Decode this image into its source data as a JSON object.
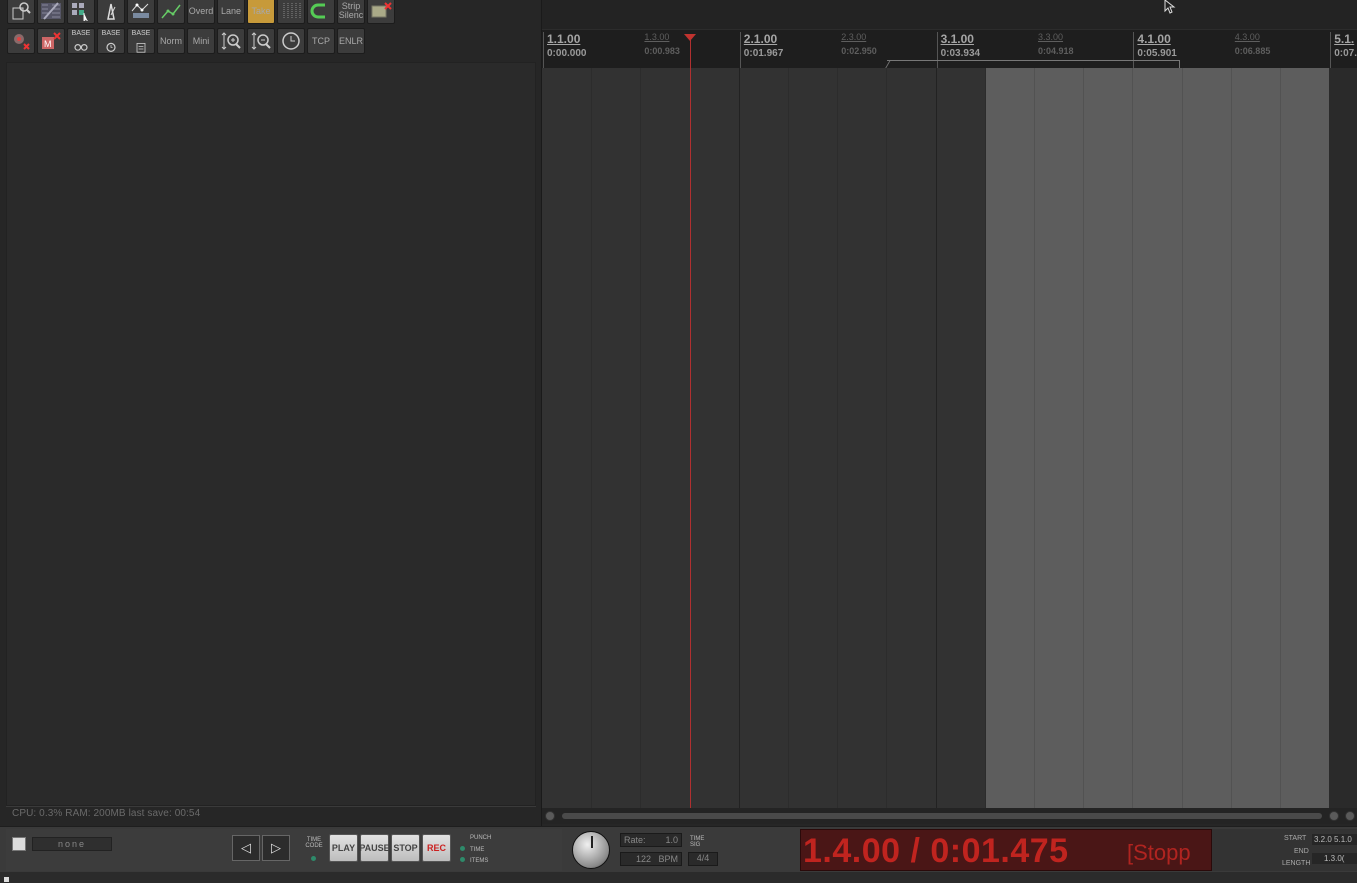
{
  "toolbar": {
    "row1": [
      {
        "name": "open-project-icon",
        "type": "icon"
      },
      {
        "name": "ripple-edit-icon",
        "type": "icon"
      },
      {
        "name": "grid-snap-icon",
        "type": "icon"
      },
      {
        "name": "metronome-icon",
        "type": "icon"
      },
      {
        "name": "envelope-points-icon",
        "type": "icon"
      },
      {
        "name": "automation-icon",
        "type": "icon"
      },
      {
        "name": "overdub-button",
        "label": "Overd"
      },
      {
        "name": "lane-button",
        "label": "Lane"
      },
      {
        "name": "take-button",
        "label": "Take"
      },
      {
        "name": "grid-lines-icon",
        "type": "icon"
      },
      {
        "name": "loop-icon",
        "type": "icon"
      },
      {
        "name": "strip-silence-button",
        "label": "Strip Silenc"
      },
      {
        "name": "remove-item-icon",
        "type": "icon"
      }
    ],
    "row2": [
      {
        "name": "record-arm-off-icon",
        "type": "icon"
      },
      {
        "name": "mute-clear-icon",
        "type": "icon"
      },
      {
        "name": "base-tape-icon",
        "label": "BASE"
      },
      {
        "name": "base-clock-icon",
        "label": "BASE"
      },
      {
        "name": "base-page-icon",
        "label": "BASE"
      },
      {
        "name": "norm-button",
        "label": "Norm"
      },
      {
        "name": "mini-button",
        "label": "Mini"
      },
      {
        "name": "zoom-in-vertical-icon",
        "type": "icon"
      },
      {
        "name": "zoom-out-vertical-icon",
        "type": "icon"
      },
      {
        "name": "clock-icon",
        "type": "icon"
      },
      {
        "name": "tcp-button",
        "label": "TCP"
      },
      {
        "name": "enlr-button",
        "label": "ENLR"
      }
    ]
  },
  "status": {
    "text": "CPU: 0.3%  RAM: 200MB  last save: 00:54"
  },
  "ruler": {
    "marks": [
      {
        "bar": "1.1.00",
        "time": "0:00.000",
        "major": true
      },
      {
        "bar": "1.3.00",
        "time": "0:00.983",
        "major": false
      },
      {
        "bar": "2.1.00",
        "time": "0:01.967",
        "major": true
      },
      {
        "bar": "2.3.00",
        "time": "0:02.950",
        "major": false
      },
      {
        "bar": "3.1.00",
        "time": "0:03.934",
        "major": true
      },
      {
        "bar": "3.3.00",
        "time": "0:04.918",
        "major": false
      },
      {
        "bar": "4.1.00",
        "time": "0:05.901",
        "major": true
      },
      {
        "bar": "4.3.00",
        "time": "0:06.885",
        "major": false
      },
      {
        "bar": "5.1.",
        "time": "0:07.",
        "major": true
      }
    ]
  },
  "transport": {
    "master_name": "none",
    "prev_label": "◁",
    "next_label": "▷",
    "timecode_label": "TIME CODE",
    "play_label": "PLAY",
    "pause_label": "PAUSE",
    "stop_label": "STOP",
    "rec_label": "REC",
    "punch_label": "PUNCH",
    "time_label": "TIME",
    "items_label": "ITEMS",
    "rate_label": "Rate:",
    "rate_value": "1.0",
    "bpm_value": "122",
    "bpm_label": "BPM",
    "timesig_label": "TIME SIG",
    "timesig_value": "4/4",
    "position": "1.4.00 / 0:01.475",
    "state": "[Stopp",
    "start_label": "START",
    "end_label": "END",
    "length_label": "LENGTH",
    "sel_start": "3.2.0",
    "sel_end": "5.1.0",
    "sel_length": "1.3.0("
  },
  "colors": {
    "time_display_text": "#c0241f",
    "cursor": "#b03030",
    "take_highlight": "#c79a3a"
  }
}
